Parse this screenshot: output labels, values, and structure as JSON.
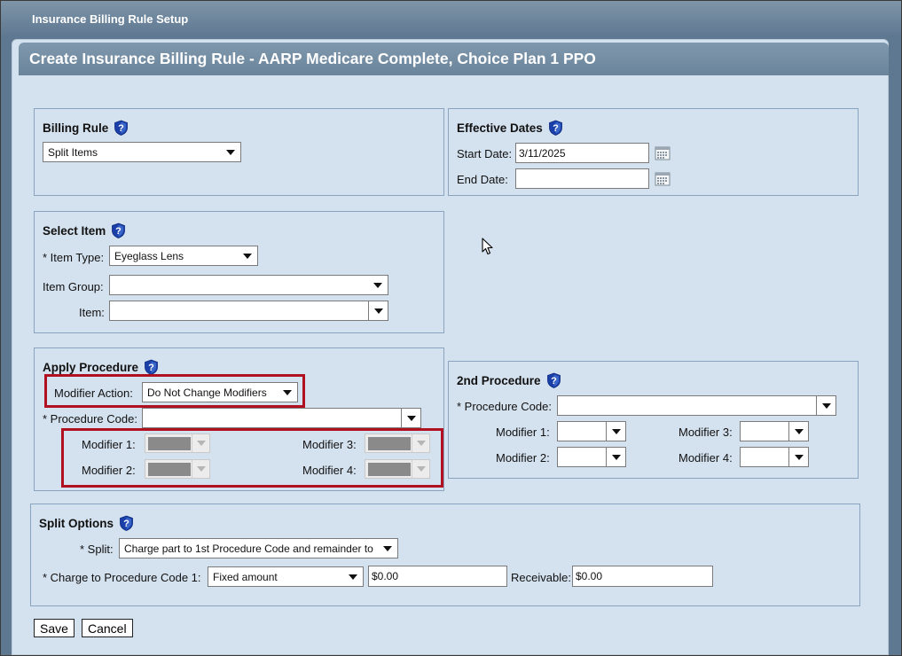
{
  "window": {
    "title": "Insurance Billing Rule Setup"
  },
  "header": {
    "title": "Create Insurance Billing Rule - AARP Medicare Complete, Choice Plan 1 PPO"
  },
  "billing_rule": {
    "title": "Billing Rule",
    "value": "Split Items"
  },
  "effective_dates": {
    "title": "Effective Dates",
    "start_label": "Start Date:",
    "start_value": "3/11/2025",
    "end_label": "End Date:",
    "end_value": ""
  },
  "select_item": {
    "title": "Select Item",
    "item_type_label": "* Item Type:",
    "item_type_value": "Eyeglass Lens",
    "item_group_label": "Item Group:",
    "item_group_value": "",
    "item_label": "Item:",
    "item_value": ""
  },
  "apply_procedure": {
    "title": "Apply Procedure",
    "modifier_action_label": "Modifier Action:",
    "modifier_action_value": "Do Not Change Modifiers",
    "procedure_code_label": "* Procedure Code:",
    "procedure_code_value": "",
    "modifier1_label": "Modifier 1:",
    "modifier2_label": "Modifier 2:",
    "modifier3_label": "Modifier 3:",
    "modifier4_label": "Modifier 4:"
  },
  "second_procedure": {
    "title": "2nd Procedure",
    "procedure_code_label": "* Procedure Code:",
    "procedure_code_value": "",
    "modifier1_label": "Modifier 1:",
    "modifier2_label": "Modifier 2:",
    "modifier3_label": "Modifier 3:",
    "modifier4_label": "Modifier 4:"
  },
  "split_options": {
    "title": "Split Options",
    "split_label": "* Split:",
    "split_value": "Charge part to 1st Procedure Code and remainder to",
    "charge_label": "* Charge to Procedure Code 1:",
    "charge_type_value": "Fixed amount",
    "charge_amount_value": "$0.00",
    "receivable_label": "Receivable:",
    "receivable_value": "$0.00"
  },
  "buttons": {
    "save": "Save",
    "cancel": "Cancel"
  },
  "colors": {
    "header": "#6f889f",
    "panel": "#d4e1ee",
    "highlight": "#b01020",
    "help_icon": "#1a3fa8"
  }
}
